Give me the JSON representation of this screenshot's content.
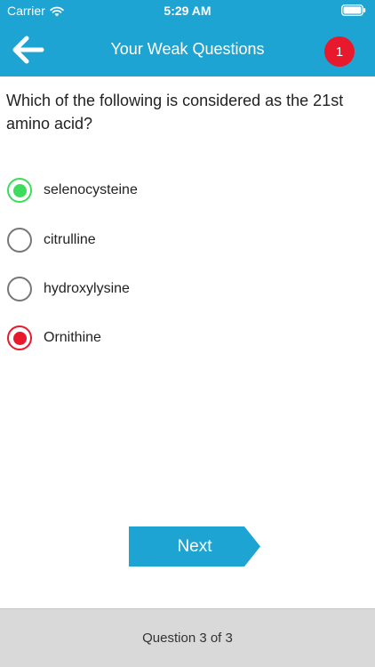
{
  "status_bar": {
    "carrier": "Carrier",
    "time": "5:29 AM",
    "wifi_icon": "wifi-icon",
    "battery_icon": "battery-icon"
  },
  "nav": {
    "back_icon": "arrow-left-icon",
    "title": "Your Weak Questions",
    "badge_count": "1",
    "colors": {
      "background": "#1ea4d2",
      "badge": "#e8192c"
    }
  },
  "question": {
    "text": "Which of the following is considered as the 21st amino acid?",
    "options": [
      {
        "label": "selenocysteine",
        "state": "correct"
      },
      {
        "label": "citrulline",
        "state": "unselected"
      },
      {
        "label": "hydroxylysine",
        "state": "unselected"
      },
      {
        "label": "Ornithine",
        "state": "wrong"
      }
    ],
    "colors": {
      "correct": "#3ddc5c",
      "wrong": "#e8192c",
      "unselected": "#777777"
    }
  },
  "next_button": {
    "label": "Next",
    "color": "#1ea4d2"
  },
  "footer": {
    "progress_label": "Question 3 of 3"
  }
}
